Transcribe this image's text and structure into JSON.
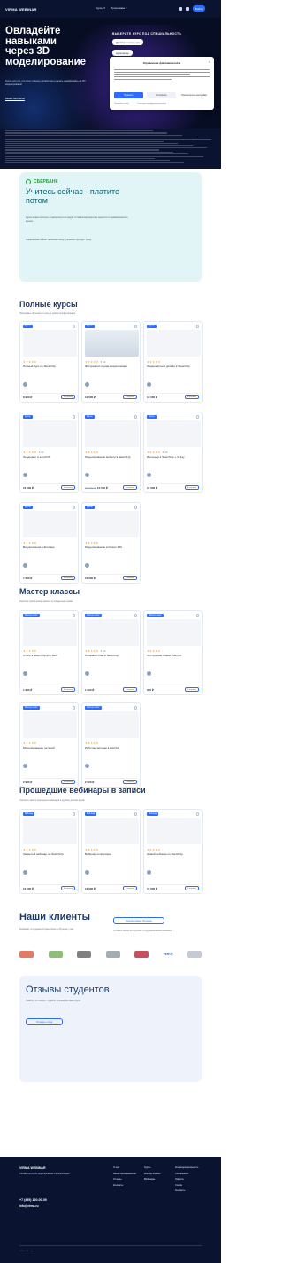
{
  "header": {
    "logo": "VIRMA WEBINAR",
    "nav": [
      "Курсы ▾",
      "Программы ▾"
    ],
    "button": "Войти"
  },
  "hero": {
    "title": "Овладейте\nнавыками\nчерез 3D\nмоделирование",
    "subtitle": "Курсы для тех, кто хочет освоить профессию и начать зарабатывать на 3D-моделировании",
    "link": "Начать бесплатно",
    "form_title": "ВЫБЕРИТЕ КУРС ПОД СПЕЦИАЛЬНОСТЬ",
    "options": [
      "Дизайнер интерьера",
      "Архитектор",
      "Ландшафтный дизайнер",
      "Визуализатор"
    ]
  },
  "cookie": {
    "title": "Управление файлами cookie",
    "close": "×",
    "buttons": [
      "Принять",
      "Отклонить",
      "Просмотреть настройки"
    ],
    "footer": [
      "Политика cookie",
      "Политика конфиденциальности"
    ]
  },
  "sber": {
    "brand": "СБЕРБАНК",
    "title": "Учитесь сейчас - платите потом",
    "text1": "Курсы можно оплатить в рассрочку или кредит от банка-партнера без переплат и первоначального взноса.",
    "text2": "Оформление займет несколько минут, решение приходит сразу."
  },
  "sections": {
    "courses_title": "Полные курсы",
    "courses_text": "Программы обучения от нуля до уровня профессионала",
    "masters_title": "Мастер классы",
    "masters_text": "Короткие практические занятия по конкретным темам",
    "webinars_title": "Прошедшие вебинары в записи",
    "webinars_text": "Смотрите записи прошедших вебинаров в удобное для вас время"
  },
  "courses": [
    {
      "badge": "Курсы",
      "title": "Полный курс по SketchUp",
      "reviews": "",
      "price": "8 900 ₽",
      "old": "",
      "btn": "В корзину"
    },
    {
      "badge": "Курсы",
      "title": "Фотореалистичная визуализация",
      "reviews": "5.00",
      "price": "12 000 ₽",
      "old": "",
      "btn": "В корзину"
    },
    {
      "badge": "Курсы",
      "title": "Ландшафтный дизайн в SketchUp",
      "reviews": "",
      "price": "10 000 ₽",
      "old": "",
      "btn": "В корзину"
    },
    {
      "badge": "Курсы",
      "title": "Лендшафт в Land FX",
      "reviews": "5.00",
      "price": "10 000 ₽",
      "old": "",
      "btn": "В корзину"
    },
    {
      "badge": "Курсы",
      "title": "Моделирование мебели в SketchUp",
      "reviews": "",
      "price": "10 000 ₽",
      "old": "15 000 ₽",
      "btn": "В корзину"
    },
    {
      "badge": "Курсы",
      "title": "Интерьер в SketchUp + V-Ray",
      "reviews": "5.00",
      "price": "10 000 ₽",
      "old": "",
      "btn": "В корзину"
    },
    {
      "badge": "Курсы",
      "title": "Визуализация в Enscape",
      "reviews": "",
      "price": "7 000 ₽",
      "old": "",
      "btn": "В корзину"
    },
    {
      "badge": "Курсы",
      "title": "Моделирование в Fusion 360",
      "reviews": "",
      "price": "10 000 ₽",
      "old": "",
      "btn": "В корзину"
    }
  ],
  "masters": [
    {
      "badge": "Мастер-класс",
      "title": "Стиль в SketchUp для ВКР",
      "reviews": "",
      "price": "1 990 ₽",
      "old": "",
      "btn": "В корзину"
    },
    {
      "badge": "Мастер-класс",
      "title": "Сложный план в SketchUp",
      "reviews": "5.00",
      "price": "1 990 ₽",
      "old": "",
      "btn": "В корзину"
    },
    {
      "badge": "Мастер-класс",
      "title": "Построение плана участка",
      "reviews": "",
      "price": "990 ₽",
      "old": "",
      "btn": "В корзину"
    },
    {
      "badge": "Мастер-класс",
      "title": "Моделирование деталей",
      "reviews": "",
      "price": "2 990 ₽",
      "old": "",
      "btn": "В корзину"
    },
    {
      "badge": "Мастер-класс",
      "title": "Рабочие чертежи в LayOut",
      "reviews": "",
      "price": "2 990 ₽",
      "old": "",
      "btn": "В корзину"
    }
  ],
  "webinars": [
    {
      "badge": "Вебинар",
      "title": "Закрытый вебинар по SketchUp",
      "reviews": "",
      "price": "10 000 ₽",
      "old": "",
      "btn": "В корзину"
    },
    {
      "badge": "Вебинар",
      "title": "Вебинар по Enscape",
      "reviews": "",
      "price": "10 000 ₽",
      "old": "",
      "btn": "В корзину"
    },
    {
      "badge": "Вебинар",
      "title": "Живой вебинар по SketchUp",
      "reviews": "",
      "price": "10 000 ₽",
      "old": "",
      "btn": "В корзину"
    }
  ],
  "clients": {
    "title": "Наши клиенты",
    "text": "Компании, сотрудники которых прошли обучение у нас",
    "button": "Корпоративное обучение",
    "text2": "Оставьте заявку на обучение сотрудников вашей компании",
    "logos": [
      {
        "name": "",
        "color": "#d6502f"
      },
      {
        "name": "",
        "color": "#6aa84f"
      },
      {
        "name": "",
        "color": "#555555"
      },
      {
        "name": "",
        "color": "#8a8f99"
      },
      {
        "name": "",
        "color": "#b2162a"
      },
      {
        "name": "VERTO",
        "color": "#1b5fb0"
      },
      {
        "name": "",
        "color": "#b3b9c4"
      }
    ]
  },
  "reviews": {
    "title": "Отзывы студентов",
    "text": "Узнайте, что говорят студенты, прошедшие наши курсы",
    "button": "Оставить отзыв"
  },
  "footer": {
    "logo": "VIRMA WEBINAR",
    "text": "Онлайн-школа 3D-моделирования и визуализации",
    "phone": "+7 (495) 120-00-00",
    "email": "info@virma.ru",
    "col1": [
      "О нас",
      "Наши преподаватели",
      "Отзывы",
      "Контакты"
    ],
    "col2": [
      "Курсы",
      "Мастер-классы",
      "Вебинары"
    ],
    "col3": [
      "Конфиденциальность",
      "Соглашение",
      "Оферта",
      "Cookie",
      "Контакты"
    ],
    "copy": "© Virma Webinar"
  },
  "colors": {
    "accent": "#2e6cff",
    "dark": "#0a1330",
    "heading": "#1b3c6a",
    "star": "#f5a623",
    "sber": "#21a038"
  }
}
